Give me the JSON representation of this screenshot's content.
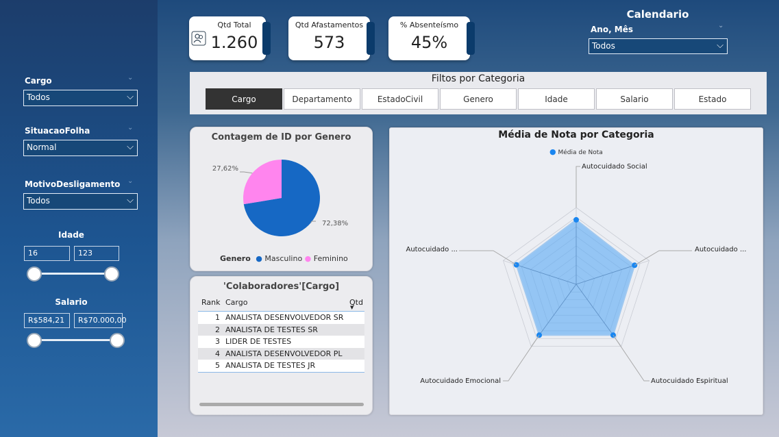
{
  "sidebar": {
    "cargo": {
      "label": "Cargo",
      "value": "Todos"
    },
    "situacao": {
      "label": "SituacaoFolha",
      "value": "Normal"
    },
    "motivo": {
      "label": "MotivoDesligamento",
      "value": "Todos"
    },
    "idade": {
      "title": "Idade",
      "min": "16",
      "max": "123"
    },
    "salario": {
      "title": "Salario",
      "min": "R$584,21",
      "max": "R$70.000,00"
    }
  },
  "kpis": [
    {
      "title": "Qtd Total",
      "value": "1.260"
    },
    {
      "title": "Qtd Afastamentos",
      "value": "573"
    },
    {
      "title": "% Absenteísmo",
      "value": "45%"
    }
  ],
  "calendario": {
    "title": "Calendario",
    "label": "Ano, Mês",
    "value": "Todos"
  },
  "filtros": {
    "title": "Filtos por Categoria",
    "buttons": [
      "Cargo",
      "Departamento",
      "EstadoCivil",
      "Genero",
      "Idade",
      "Salario",
      "Estado"
    ],
    "active": "Cargo"
  },
  "pie": {
    "title": "Contagem de ID por Genero",
    "legend_title": "Genero",
    "colors": {
      "Masculino": "#1668c4",
      "Feminino": "#ff85ee"
    }
  },
  "table": {
    "title": "'Colaboradores'[Cargo]",
    "headers": [
      "Rank",
      "Cargo",
      "Qtd"
    ],
    "rows": [
      {
        "rank": "1",
        "cargo": "ANALISTA DESENVOLVEDOR SR"
      },
      {
        "rank": "2",
        "cargo": "ANALISTA DE TESTES SR"
      },
      {
        "rank": "3",
        "cargo": "LIDER DE TESTES"
      },
      {
        "rank": "4",
        "cargo": "ANALISTA DESENVOLVEDOR PL"
      },
      {
        "rank": "5",
        "cargo": "ANALISTA DE TESTES JR"
      }
    ]
  },
  "radar": {
    "title": "Média de Nota por Categoria",
    "legend": "Média de Nota",
    "color": "#1a86f0"
  },
  "chart_data": [
    {
      "type": "pie",
      "title": "Contagem de ID por Genero",
      "categories": [
        "Masculino",
        "Feminino"
      ],
      "values": [
        72.38,
        27.62
      ],
      "labels": [
        "72,38%",
        "27,62%"
      ],
      "legend_title": "Genero"
    },
    {
      "type": "radar",
      "title": "Média de Nota por Categoria",
      "categories": [
        "Autocuidado Social",
        "Autocuidado ...",
        "Autocuidado Espiritual",
        "Autocuidado Emocional",
        "Autocuidado ..."
      ],
      "series": [
        {
          "name": "Média de Nota",
          "values": [
            0.84,
            0.8,
            0.82,
            0.82,
            0.82
          ]
        }
      ],
      "ylim": [
        0,
        1
      ]
    }
  ]
}
